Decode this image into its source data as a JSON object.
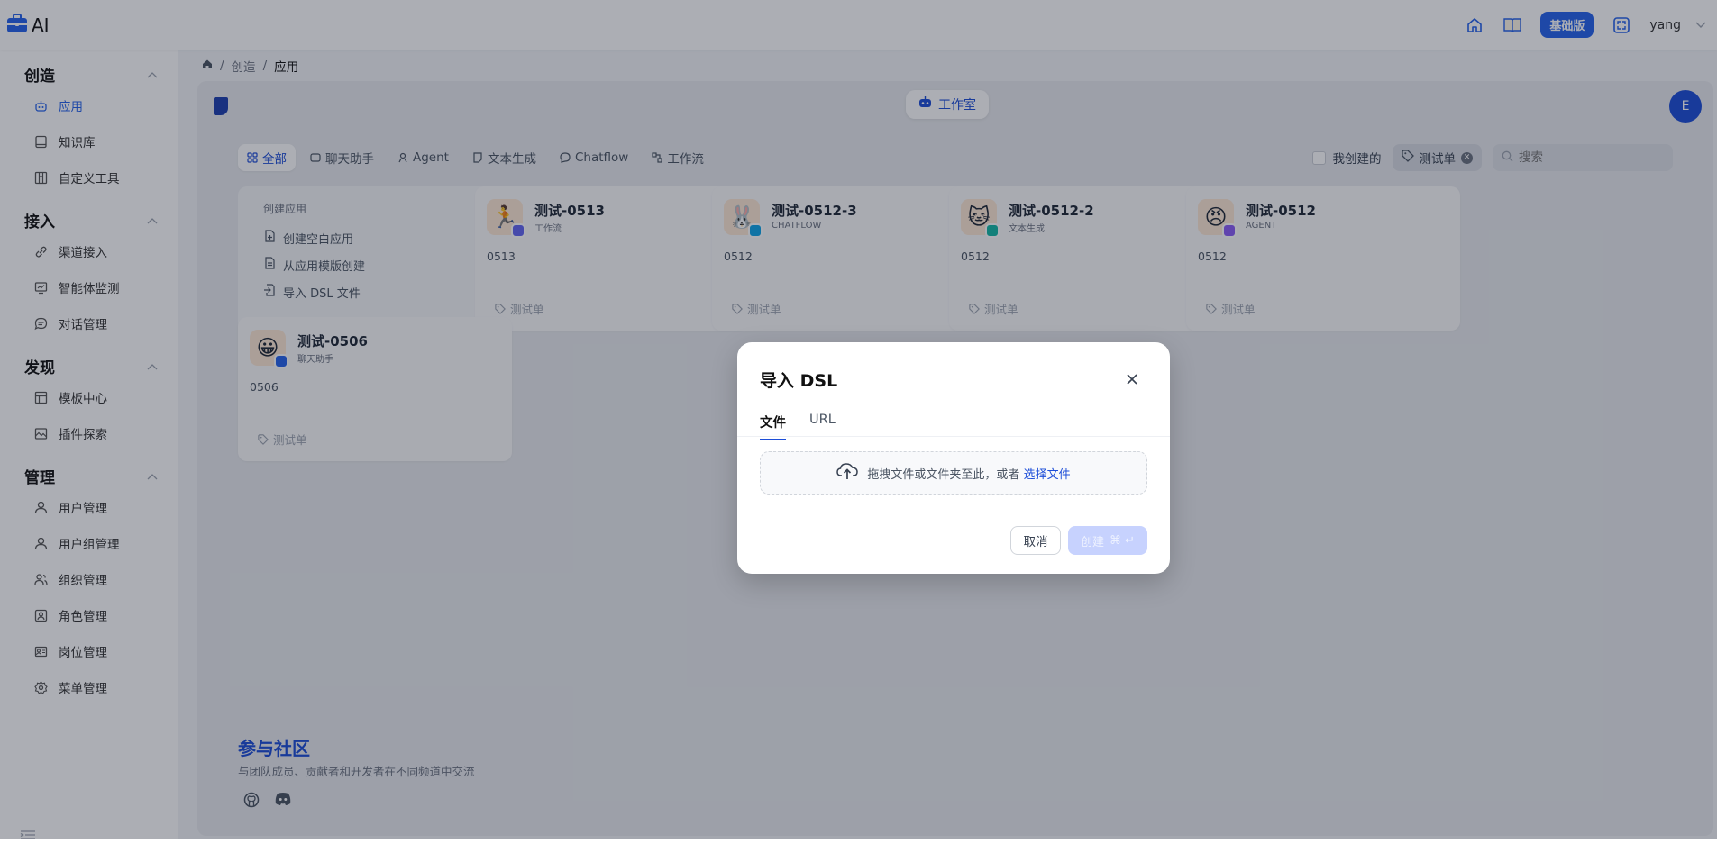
{
  "app": {
    "title": "AI"
  },
  "topbar": {
    "edition_label": "基础版",
    "user_name": "yang"
  },
  "sidebar": {
    "groups": [
      {
        "title": "创造",
        "items": [
          {
            "label": "应用",
            "active": true
          },
          {
            "label": "知识库"
          },
          {
            "label": "自定义工具"
          }
        ]
      },
      {
        "title": "接入",
        "items": [
          {
            "label": "渠道接入"
          },
          {
            "label": "智能体监测"
          },
          {
            "label": "对话管理"
          }
        ]
      },
      {
        "title": "发现",
        "items": [
          {
            "label": "模板中心"
          },
          {
            "label": "插件探索"
          }
        ]
      },
      {
        "title": "管理",
        "items": [
          {
            "label": "用户管理"
          },
          {
            "label": "用户组管理"
          },
          {
            "label": "组织管理"
          },
          {
            "label": "角色管理"
          },
          {
            "label": "岗位管理"
          },
          {
            "label": "菜单管理"
          }
        ]
      }
    ]
  },
  "breadcrumb": {
    "items": [
      "创造",
      "应用"
    ]
  },
  "workspace": {
    "studio_label": "工作室",
    "avatar_letter": "E",
    "filters": {
      "tabs": [
        {
          "label": "全部",
          "active": true
        },
        {
          "label": "聊天助手"
        },
        {
          "label": "Agent"
        },
        {
          "label": "文本生成"
        },
        {
          "label": "Chatflow"
        },
        {
          "label": "工作流"
        }
      ],
      "mine_label": "我创建的",
      "tag_label": "测试单",
      "search_placeholder": "搜索"
    },
    "create_card": {
      "title": "创建应用",
      "options": [
        "创建空白应用",
        "从应用模版创建",
        "导入 DSL 文件"
      ]
    },
    "apps": [
      {
        "name": "测试-0513",
        "type": "工作流",
        "desc": "0513",
        "tag": "测试单",
        "emoji": "🏃",
        "badge_color": "#6366f1"
      },
      {
        "name": "测试-0512-3",
        "type": "CHATFLOW",
        "desc": "0512",
        "tag": "测试单",
        "emoji": "🐰",
        "badge_color": "#0ea5e9"
      },
      {
        "name": "测试-0512-2",
        "type": "文本生成",
        "desc": "0512",
        "tag": "测试单",
        "emoji": "🐱",
        "badge_color": "#14b8a6"
      },
      {
        "name": "测试-0512",
        "type": "AGENT",
        "desc": "0512",
        "tag": "测试单",
        "emoji": "😠",
        "badge_color": "#8b5cf6"
      },
      {
        "name": "测试-0506",
        "type": "聊天助手",
        "desc": "0506",
        "tag": "测试单",
        "emoji": "😀",
        "badge_color": "#2563eb"
      }
    ],
    "community": {
      "title": "参与社区",
      "subtitle": "与团队成员、贡献者和开发者在不同频道中交流"
    }
  },
  "modal": {
    "title": "导入 DSL",
    "tabs": [
      {
        "label": "文件",
        "active": true
      },
      {
        "label": "URL"
      }
    ],
    "dropzone_text": "拖拽文件或文件夹至此，或者",
    "dropzone_link": "选择文件",
    "cancel_label": "取消",
    "create_label": "创建",
    "create_shortcut": "⌘ ↵"
  }
}
